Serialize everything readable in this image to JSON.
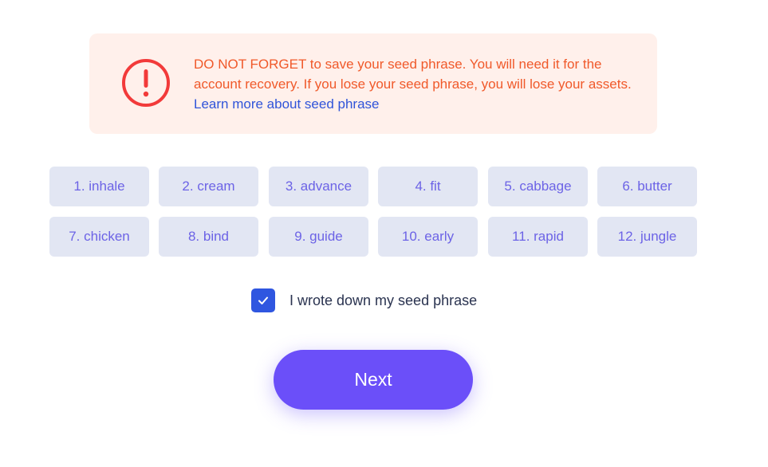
{
  "warning": {
    "emphasis": "DO NOT FORGET",
    "message": " to save your seed phrase. You will need it for the account recovery. If you lose your seed phrase, you will lose your assets.",
    "link_label": "Learn more about seed phrase",
    "icon": "exclamation-circle-icon",
    "color": "#f0592a",
    "background": "#fff0eb"
  },
  "seed_words": [
    "1. inhale",
    "2. cream",
    "3. advance",
    "4. fit",
    "5. cabbage",
    "6. butter",
    "7. chicken",
    "8. bind",
    "9. guide",
    "10. early",
    "11. rapid",
    "12. jungle"
  ],
  "confirmation": {
    "checked": true,
    "label": "I wrote down my seed phrase"
  },
  "next_button": {
    "label": "Next",
    "color": "#6b4ff9"
  }
}
